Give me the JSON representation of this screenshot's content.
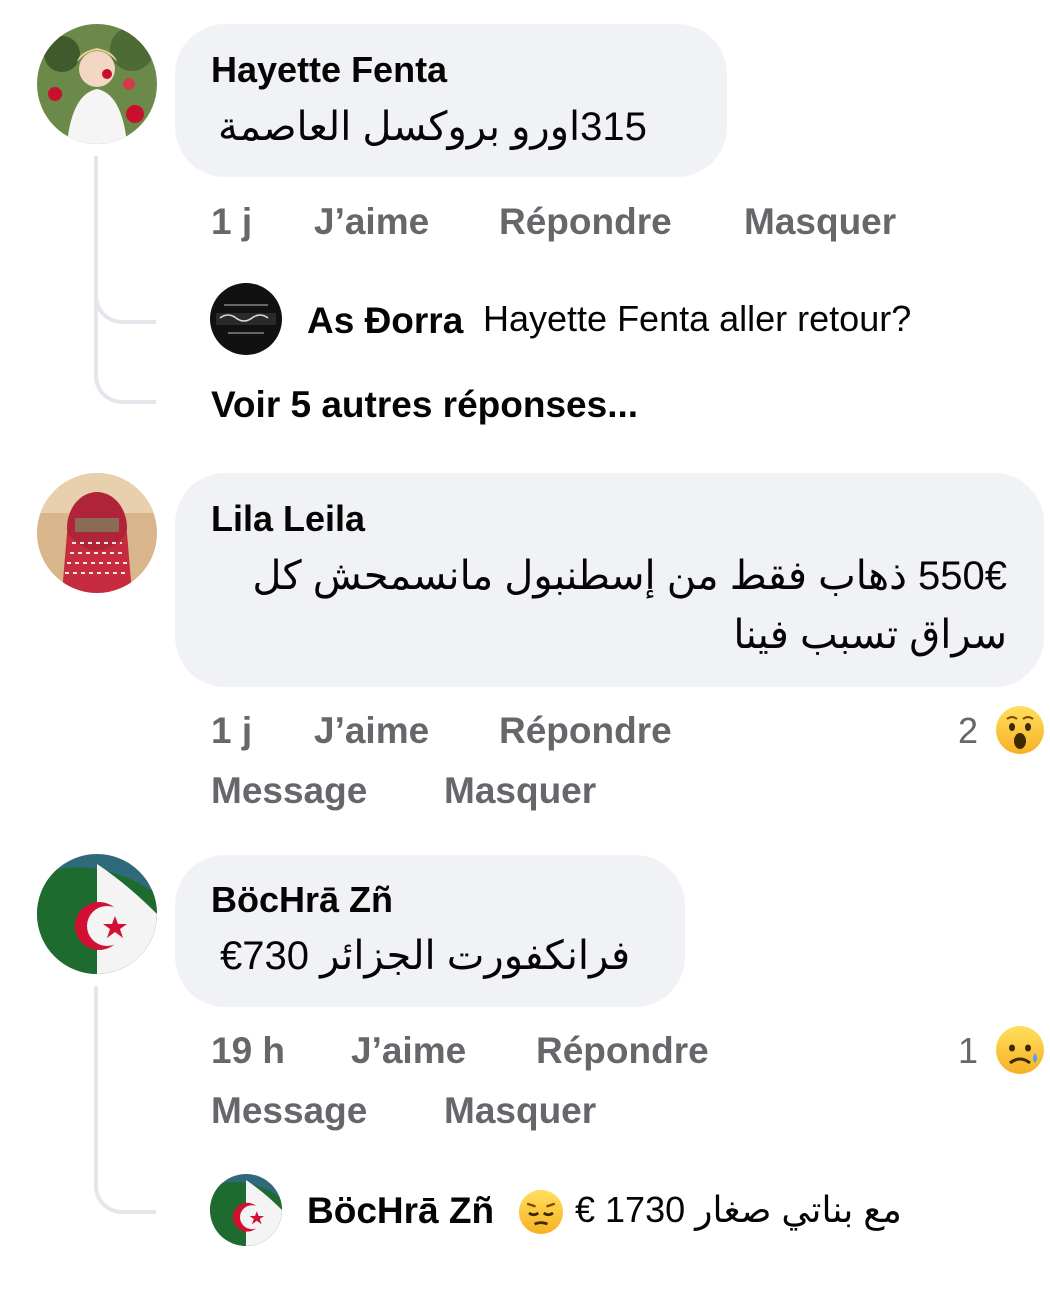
{
  "comments": [
    {
      "author": "Hayette Fenta",
      "text": "315اورو  بروكسل العاصمة",
      "time": "1 j",
      "actions": [
        "J’aime",
        "Répondre",
        "Masquer"
      ],
      "reply": {
        "author": "As Đorra",
        "text": "Hayette Fenta aller retour?"
      },
      "more_replies": "Voir 5 autres réponses..."
    },
    {
      "author": "Lila Leila",
      "text_line1": "550€ ذهاب فقط من إسطنبول مانسمحش كل",
      "text_line2": "سراق تسبب فينا",
      "time": "1 j",
      "actions": [
        "J’aime",
        "Répondre",
        "Message",
        "Masquer"
      ],
      "reaction": {
        "count": "2",
        "icon": "wow-emoji-icon"
      }
    },
    {
      "author": "BöcHrā Zñ",
      "text": "فرانكفورت الجزائر 730€",
      "time": "19 h",
      "actions": [
        "J’aime",
        "Répondre",
        "Message",
        "Masquer"
      ],
      "reaction": {
        "count": "1",
        "icon": "sad-emoji-icon"
      },
      "reply": {
        "author": "BöcHrā Zñ",
        "text": "مع بناتي صغار 1730 €",
        "emoji": "pensive-emoji-icon"
      }
    }
  ],
  "colors": {
    "bubble": "#f0f2f5",
    "meta": "#65676b",
    "text": "#050505",
    "thread_line": "#e4e6eb"
  }
}
